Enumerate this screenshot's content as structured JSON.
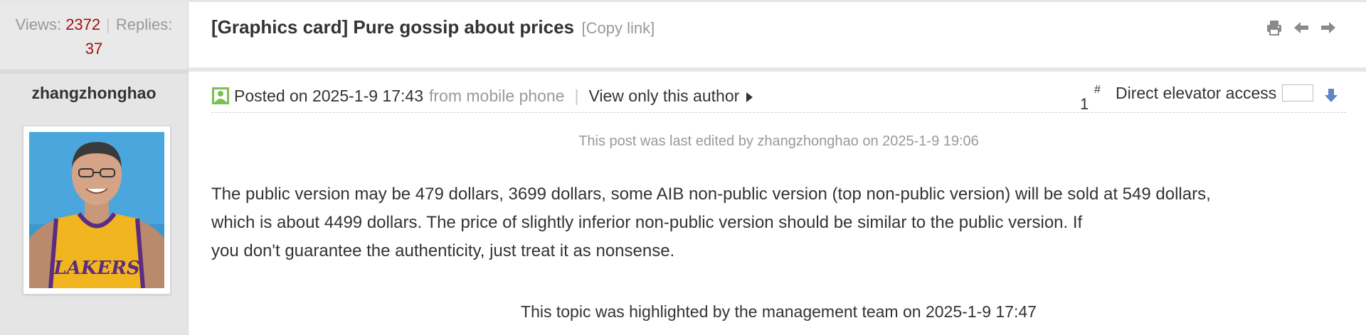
{
  "stats": {
    "views_label": "Views:",
    "views_value": "2372",
    "separator": "|",
    "replies_label": "Replies:",
    "replies_value": "37"
  },
  "thread": {
    "title": "[Graphics card] Pure gossip about prices",
    "copy_link": "[Copy link]",
    "tools": [
      "print-icon",
      "previous-arrow-icon",
      "next-arrow-icon"
    ]
  },
  "author": {
    "name": "zhangzhonghao",
    "avatar_jersey_text": "LAKERS"
  },
  "post": {
    "posted_on": "Posted on 2025-1-9 17:43",
    "via": "from mobile phone",
    "separator": "|",
    "view_only_author": "View only this author",
    "floor_number": "1",
    "floor_hash": "#",
    "elevator_label": "Direct elevator access",
    "elevator_value": "",
    "edit_note": "This post was last edited by zhangzhonghao on 2025-1-9 19:06",
    "body_lines": [
      "The public version may be 479 dollars, 3699 dollars, some AIB non-public version (top non-public version) will be sold at 549 dollars,",
      "which is about 4499 dollars. The price of slightly inferior non-public version should be similar to the public version. If",
      "you don't guarantee the authenticity, just treat it as nonsense."
    ],
    "highlight_note": "This topic was highlighted by the management team on 2025-1-9 17:47"
  },
  "colors": {
    "stat_number": "#a20f0f",
    "muted_text": "#999999",
    "main_text": "#333333",
    "sidebar_bg": "#e5e5e5",
    "online_icon": "#7bbf4f",
    "elevator_arrow": "#5b86c8"
  }
}
